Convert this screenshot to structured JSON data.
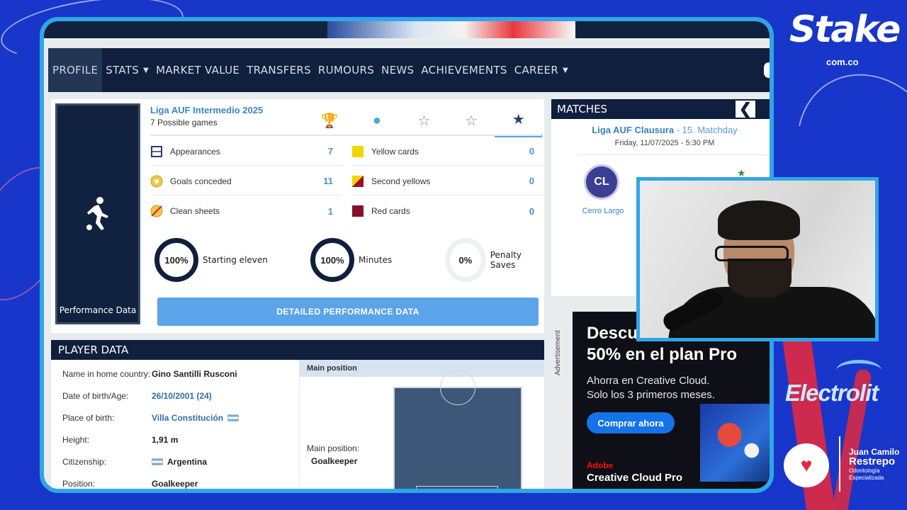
{
  "nav": {
    "items": [
      "PROFILE",
      "STATS",
      "MARKET VALUE",
      "TRANSFERS",
      "RUMOURS",
      "NEWS",
      "ACHIEVEMENTS",
      "CAREER"
    ],
    "active": "PROFILE"
  },
  "performance": {
    "side_caption": "Performance Data",
    "competition": "Liga AUF Intermedio 2025",
    "possible_games": "7 Possible games",
    "stats_left": [
      {
        "label": "Appearances",
        "value": "7",
        "icon": "pitch-icon"
      },
      {
        "label": "Goals conceded",
        "value": "11",
        "icon": "ball-icon"
      },
      {
        "label": "Clean sheets",
        "value": "1",
        "icon": "no-goal-icon"
      }
    ],
    "stats_right": [
      {
        "label": "Yellow cards",
        "value": "0",
        "icon": "yellow-card-icon"
      },
      {
        "label": "Second yellows",
        "value": "0",
        "icon": "second-yellow-icon"
      },
      {
        "label": "Red cards",
        "value": "0",
        "icon": "red-card-icon"
      }
    ],
    "rings": [
      {
        "value": "100%",
        "label": "Starting eleven",
        "fraction": 1.0
      },
      {
        "value": "100%",
        "label": "Minutes",
        "fraction": 1.0
      },
      {
        "value": "0%",
        "label": "Penalty Saves",
        "fraction": 0.0
      }
    ],
    "detail_button": "DETAILED PERFORMANCE DATA"
  },
  "player_data": {
    "title": "PLAYER DATA",
    "rows": [
      {
        "key": "Name in home country:",
        "value": "Gino Santilli Rusconi"
      },
      {
        "key": "Date of birth/Age:",
        "value": "26/10/2001 (24)"
      },
      {
        "key": "Place of birth:",
        "value": "Villa Constitución"
      },
      {
        "key": "Height:",
        "value": "1,91 m"
      },
      {
        "key": "Citizenship:",
        "value": "Argentina"
      },
      {
        "key": "Position:",
        "value": "Goalkeeper"
      }
    ],
    "position_header": "Main position",
    "position_label": "Main position:",
    "position_value": "Goalkeeper"
  },
  "matches": {
    "title": "MATCHES",
    "league": "Liga AUF Clausura",
    "matchday": " - 15. Matchday",
    "date": "Friday, 11/07/2025 - 5:30 PM",
    "home_team": "Cerro Largo",
    "home_abbr": "CL"
  },
  "ad": {
    "side_label": "Advertisement",
    "headline_1": "Descuento del",
    "headline_2": "50% en el plan Pro",
    "body_1": "Ahorra en Creative Cloud.",
    "body_2": "Solo los 3 primeros meses.",
    "cta": "Comprar ahora",
    "brand": "Adobe",
    "product": "Creative Cloud Pro"
  },
  "branding": {
    "stake": "Stake",
    "stake_sub": "com.co",
    "electrolit": "Electrolit",
    "doc_line1": "Juan Camilo",
    "doc_line2": "Restrepo",
    "doc_line3": "Odontología",
    "doc_line4": "Especializada"
  },
  "colors": {
    "navy": "#0f1f3d",
    "accent_blue": "#5ba4ea",
    "frame_cyan": "#2fa6e6",
    "background_blue": "#1836c9"
  }
}
